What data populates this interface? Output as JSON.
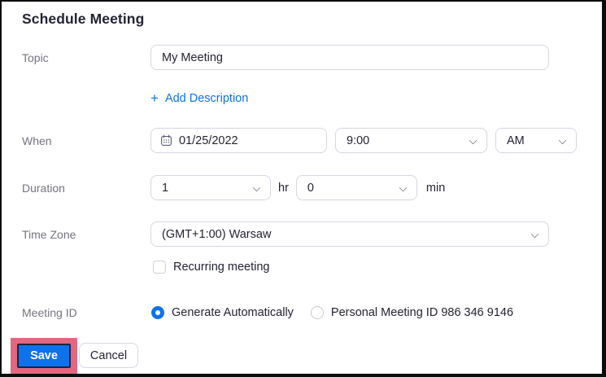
{
  "window": {
    "title": "Schedule Meeting"
  },
  "icons": {
    "plus_icon": "+",
    "calendar_icon": "calendar-outline-svg",
    "chevron_down_icon": "css-chevron"
  },
  "form": {
    "topic": {
      "label": "Topic",
      "value": "My Meeting"
    },
    "description": {
      "add_label": "Add Description"
    },
    "when": {
      "label": "When",
      "date": "01/25/2022",
      "time": "9:00",
      "meridiem": "AM"
    },
    "duration": {
      "label": "Duration",
      "hours": "1",
      "hours_unit": "hr",
      "minutes": "0",
      "minutes_unit": "min"
    },
    "timezone": {
      "label": "Time Zone",
      "value": "(GMT+1:00) Warsaw"
    },
    "recurring": {
      "label": "Recurring meeting",
      "checked": false
    },
    "meeting_id": {
      "label": "Meeting ID",
      "options": [
        {
          "label": "Generate Automatically",
          "selected": true
        },
        {
          "label": "Personal Meeting ID 986 346 9146",
          "selected": false
        }
      ]
    }
  },
  "footer": {
    "save_label": "Save",
    "cancel_label": "Cancel"
  },
  "colors": {
    "accent_blue": "#0e72ed",
    "link_blue": "#0e72ed",
    "annotation_pink": "#e0697f",
    "save_border_navy": "#1d2440",
    "text_dark": "#232333",
    "label_gray": "#74747f",
    "control_border": "#d7d7e2",
    "frame_black": "#0c0c0c"
  }
}
